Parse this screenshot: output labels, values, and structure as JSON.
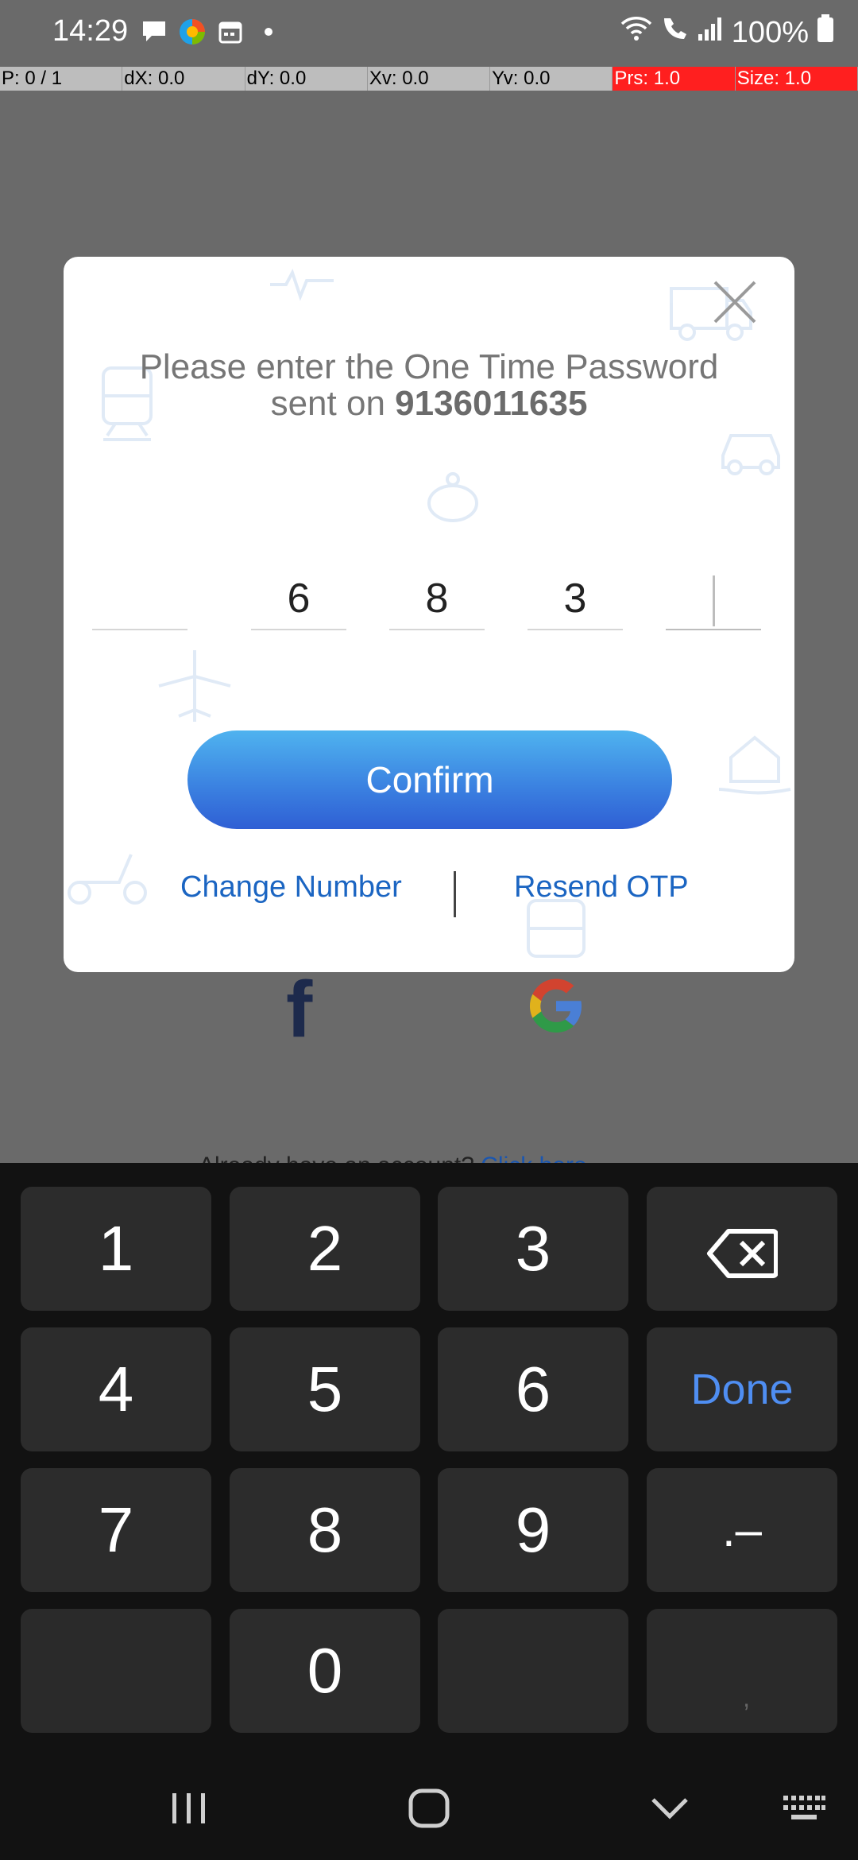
{
  "status_bar": {
    "time": "14:29",
    "battery": "100%",
    "icons": [
      "chat-icon",
      "edge-browser-icon",
      "calendar-icon",
      "dot-icon",
      "wifi-icon",
      "wifi-calling-icon",
      "signal-icon",
      "battery-icon"
    ]
  },
  "pointer_bar": {
    "p": "P: 0 / 1",
    "dx": "dX: 0.0",
    "dy": "dY: 0.0",
    "xv": "Xv: 0.0",
    "yv": "Yv: 0.0",
    "prs": "Prs: 1.0",
    "size": "Size: 1.0"
  },
  "background": {
    "social": [
      "facebook-icon",
      "google-icon"
    ],
    "text_prefix": "Already have an account?",
    "text_link": "Click here"
  },
  "modal": {
    "title_line1": "Please enter the One Time Password",
    "title_line2_prefix": "sent on ",
    "phone": "9136011635",
    "otp": [
      "",
      "6",
      "8",
      "3",
      ""
    ],
    "confirm_label": "Confirm",
    "change_number_label": "Change Number",
    "resend_otp_label": "Resend OTP"
  },
  "keyboard": {
    "keys": [
      "1",
      "2",
      "3",
      "4",
      "5",
      "6",
      "7",
      "8",
      "9",
      "0"
    ],
    "done_label": "Done",
    "dot_dash_label": ".–",
    "comma_label": ","
  },
  "colors": {
    "accent": "#3a7fe0",
    "link": "#1b65c2",
    "done": "#4f8ef2",
    "overlay": "#6a6a6a"
  }
}
